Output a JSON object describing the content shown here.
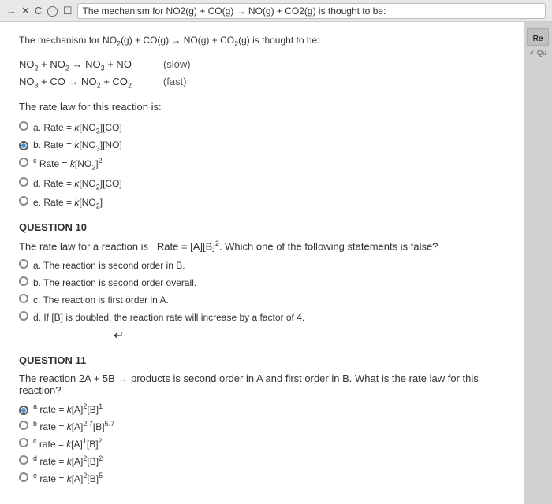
{
  "browser": {
    "url": "The mechanism for NO2(g) + CO(g) → NO(g) + CO2(g) is thought to be:"
  },
  "top_note": "The mechanism for NO₂(g) + CO(g) → NO(g) + CO₂(g) is thought to be:",
  "reactions": [
    {
      "eq": "NO₂ + NO₂ → NO₃ + NO",
      "speed": "(slow)"
    },
    {
      "eq": "NO₃ + CO → NO₂ + CO₂",
      "speed": "(fast)"
    }
  ],
  "rate_law_title": "The rate law for this reaction is:",
  "rate_options_q9": [
    {
      "id": "a",
      "label": "Rate = k[NO₃][CO]",
      "selected": false
    },
    {
      "id": "b",
      "label": "Rate = k[NO₃][NO]",
      "selected": true
    },
    {
      "id": "c",
      "label": "Rate = k[NO₂]²",
      "selected": false
    },
    {
      "id": "d",
      "label": "Rate = k[NO₂][CO]",
      "selected": false
    },
    {
      "id": "e",
      "label": "Rate = k[NO₂]",
      "selected": false
    }
  ],
  "q10": {
    "header": "QUESTION 10",
    "text": "The rate law for a reaction is   Rate = [A][B]². Which one of the following statements is false?",
    "options": [
      {
        "id": "a",
        "label": "The reaction is second order in B.",
        "selected": false
      },
      {
        "id": "b",
        "label": "The reaction is second order overall.",
        "selected": false
      },
      {
        "id": "c",
        "label": "The reaction is first order in A.",
        "selected": false
      },
      {
        "id": "d",
        "label": "If [B] is doubled, the reaction rate will increase by a factor of 4.",
        "selected": false
      }
    ]
  },
  "q11": {
    "header": "QUESTION 11",
    "text": "The reaction 2A + 5B → products is second order in A and first order in B. What is the rate law for this reaction?",
    "options": [
      {
        "id": "a",
        "label": "rate = k[A]²[B]¹",
        "selected": true
      },
      {
        "id": "b",
        "label": "rate = k[A]²·⁷[B]⁵·⁷",
        "selected": false
      },
      {
        "id": "c",
        "label": "rate = k[A]¹[B]²",
        "selected": false
      },
      {
        "id": "d",
        "label": "rate = k[A]²[B]²",
        "selected": false
      },
      {
        "id": "e",
        "label": "rate = k[A]²[B]⁵",
        "selected": false
      }
    ]
  },
  "sidebar": {
    "re_label": "Re",
    "qu_label": "✓ Qu"
  }
}
